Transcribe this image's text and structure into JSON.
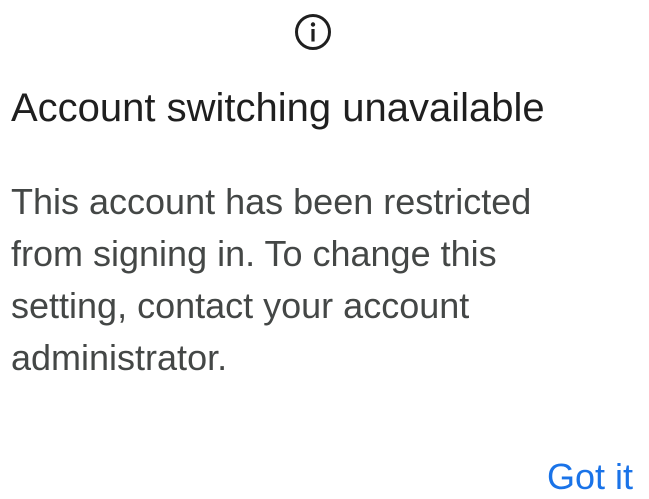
{
  "dialog": {
    "icon": "info-icon",
    "title": "Account switching unavailable",
    "message": "This account has been restricted from signing in. To change this setting, contact your account administrator.",
    "confirm_label": "Got it"
  },
  "colors": {
    "title": "#1f1f1f",
    "message": "#444746",
    "accent": "#1a73e8",
    "background": "#ffffff"
  }
}
